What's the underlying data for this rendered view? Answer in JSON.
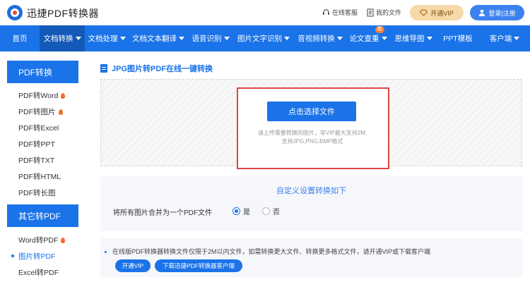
{
  "header": {
    "brand": "迅捷PDF转换器",
    "service": "在线客服",
    "my_files": "我的文件",
    "vip": "开通VIP",
    "login": "登录|注册"
  },
  "nav": {
    "items": [
      {
        "label": "首页",
        "caret": false
      },
      {
        "label": "文档转换",
        "caret": true,
        "active": true
      },
      {
        "label": "文档处理",
        "caret": true
      },
      {
        "label": "文档文本翻译",
        "caret": true
      },
      {
        "label": "语音识别",
        "caret": true
      },
      {
        "label": "图片文字识别",
        "caret": true
      },
      {
        "label": "音视频转换",
        "caret": true
      },
      {
        "label": "论文查重",
        "caret": true,
        "badge": "新"
      },
      {
        "label": "思维导图",
        "caret": true
      },
      {
        "label": "PPT模板",
        "caret": false
      },
      {
        "label": "客户端",
        "caret": true
      }
    ]
  },
  "sidebar": {
    "group1": "PDF转换",
    "group1_items": [
      {
        "label": "PDF转Word",
        "hot": true
      },
      {
        "label": "PDF转图片",
        "hot": true
      },
      {
        "label": "PDF转Excel",
        "hot": false
      },
      {
        "label": "PDF转PPT",
        "hot": false
      },
      {
        "label": "PDF转TXT",
        "hot": false
      },
      {
        "label": "PDF转HTML",
        "hot": false
      },
      {
        "label": "PDF转长图",
        "hot": false
      }
    ],
    "group2": "其它转PDF",
    "group2_items": [
      {
        "label": "Word转PDF",
        "hot": true
      },
      {
        "label": "图片转PDF",
        "hot": false,
        "selected": true
      },
      {
        "label": "Excel转PDF",
        "hot": false
      }
    ]
  },
  "main": {
    "title": "JPG图片转PDF在线一键转换",
    "choose_button": "点击选择文件",
    "hint_line1": "请上传需要转换的图片，非VIP最大支持2M,",
    "hint_line2": "支持JPG,PNG,BMP格式",
    "custom_title": "自定义设置转换如下",
    "merge_label": "将所有图片合并为一个PDF文件",
    "radio_yes": "是",
    "radio_no": "否",
    "radio_selected": "是",
    "notice": "在线版PDF转换器转换文件仅限于2M以内文件，如需转换更大文件、转换更多格式文件，请开通VIP或下载客户端",
    "vip_pill": "开通VIP",
    "download_pill": "下载迅捷PDF转换器客户端"
  },
  "colors": {
    "primary": "#1a73e8",
    "highlight_border": "#e04444",
    "vip_bg": "#f6d9a8",
    "hot_icon": "#f56b2a"
  }
}
